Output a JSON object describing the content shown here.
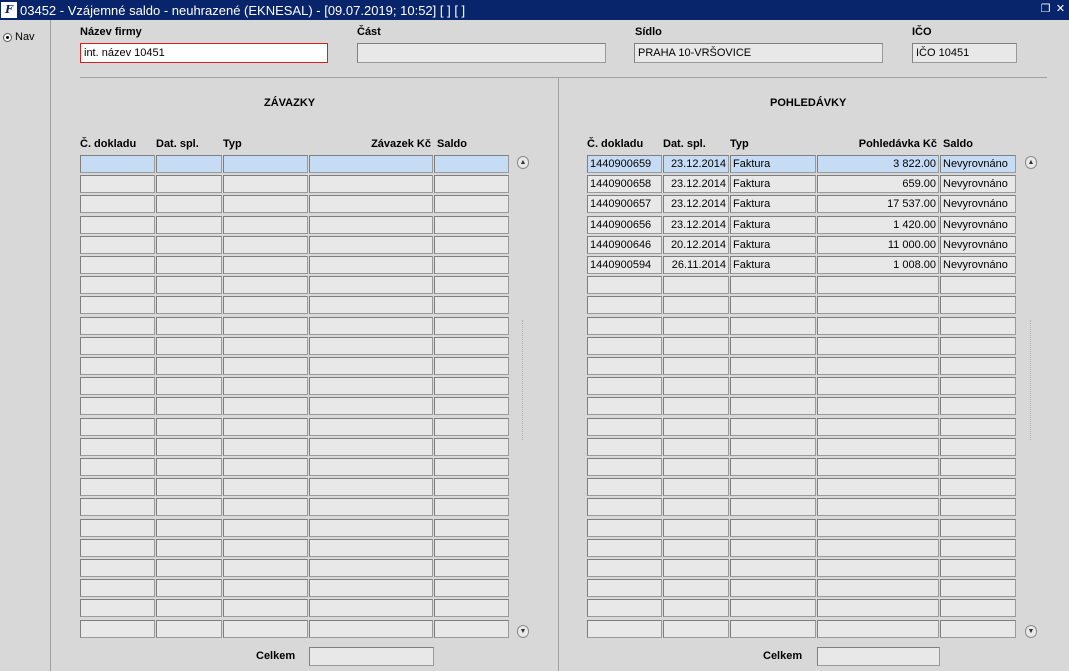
{
  "window": {
    "logo": "F",
    "title": "03452 - Vzájemné saldo - neuhrazené (EKNESAL) - [09.07.2019; 10:52]  [ ]  [ ]",
    "restore_icon": "restore-icon",
    "close_icon": "close-icon"
  },
  "nav": {
    "label": "Nav"
  },
  "header": {
    "nazev_label": "Název firmy",
    "nazev_value": "int. název 10451",
    "cast_label": "Část",
    "cast_value": "",
    "sidlo_label": "Sídlo",
    "sidlo_value": "PRAHA 10-VRŠOVICE",
    "ico_label": "IČO",
    "ico_value": "IČO 10451"
  },
  "zavazky": {
    "title": "ZÁVAZKY",
    "columns": [
      "Č. dokladu",
      "Dat. spl.",
      "Typ",
      "Závazek Kč",
      "Saldo"
    ],
    "rows": [],
    "total_label": "Celkem",
    "total_value": ""
  },
  "pohledavky": {
    "title": "POHLEDÁVKY",
    "columns": [
      "Č. dokladu",
      "Dat. spl.",
      "Typ",
      "Pohledávka Kč",
      "Saldo"
    ],
    "rows": [
      [
        "1440900659",
        "23.12.2014",
        "Faktura",
        "3 822.00",
        "Nevyrovnáno"
      ],
      [
        "1440900658",
        "23.12.2014",
        "Faktura",
        "659.00",
        "Nevyrovnáno"
      ],
      [
        "1440900657",
        "23.12.2014",
        "Faktura",
        "17 537.00",
        "Nevyrovnáno"
      ],
      [
        "1440900656",
        "23.12.2014",
        "Faktura",
        "1 420.00",
        "Nevyrovnáno"
      ],
      [
        "1440900646",
        "20.12.2014",
        "Faktura",
        "11 000.00",
        "Nevyrovnáno"
      ],
      [
        "1440900594",
        "26.11.2014",
        "Faktura",
        "1 008.00",
        "Nevyrovnáno"
      ]
    ],
    "total_label": "Celkem",
    "total_value": ""
  }
}
